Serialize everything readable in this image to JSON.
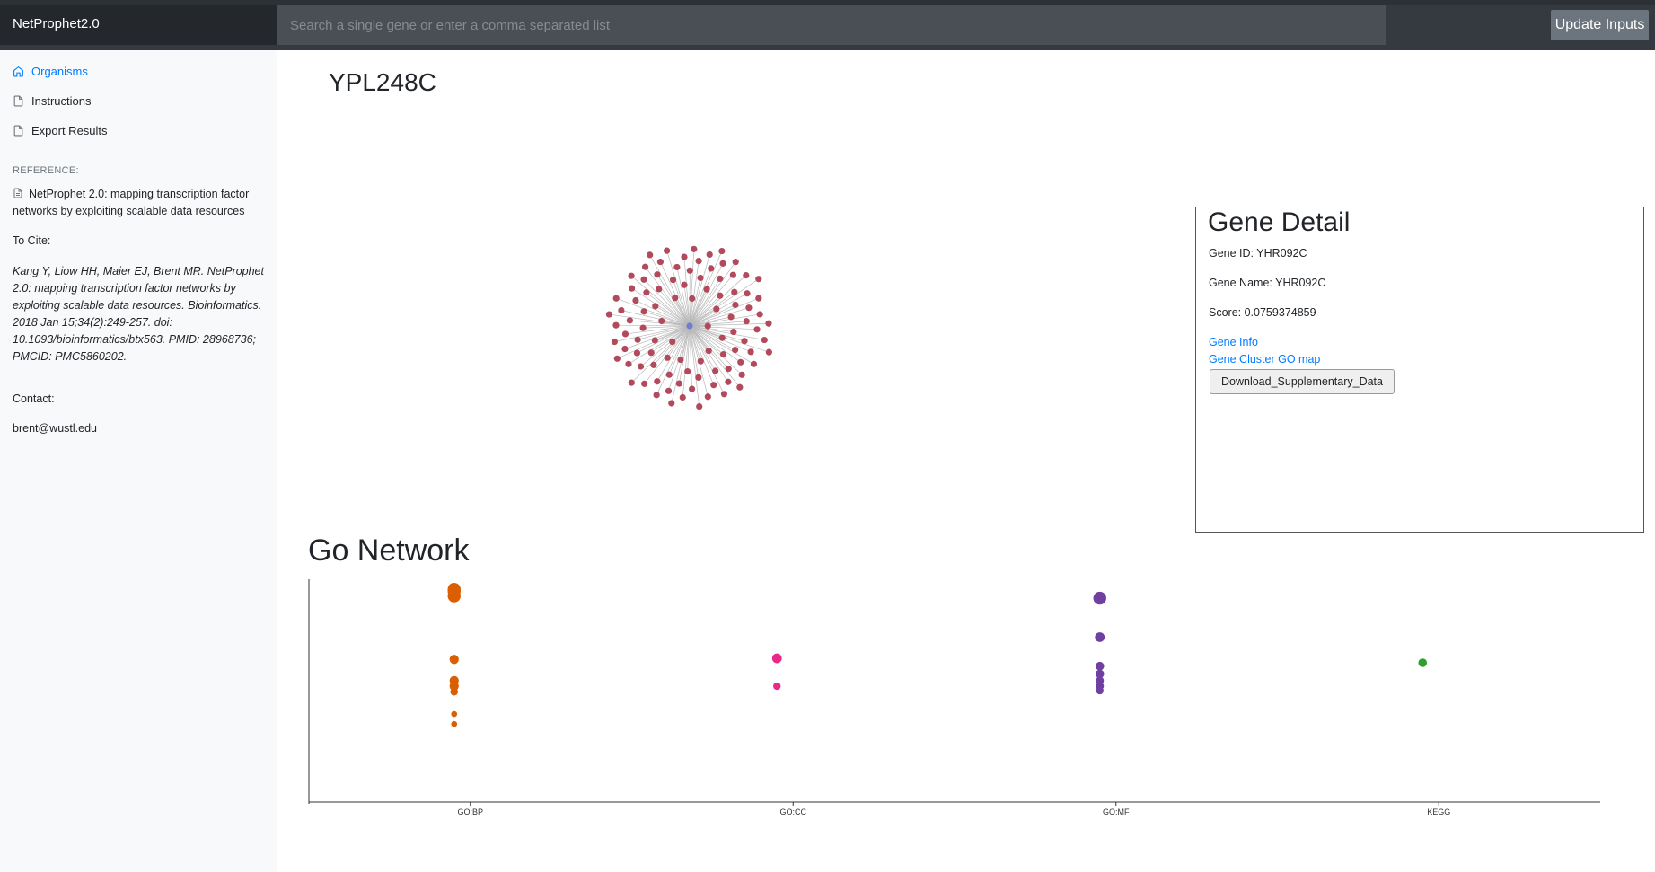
{
  "app": {
    "brand": "NetProphet2.0"
  },
  "search": {
    "placeholder": "Search a single gene or enter a comma separated list",
    "value": ""
  },
  "toolbar": {
    "update_label": "Update Inputs"
  },
  "sidebar": {
    "items": [
      {
        "label": "Organisms",
        "icon": "home-icon",
        "active": true
      },
      {
        "label": "Instructions",
        "icon": "file-icon",
        "active": false
      },
      {
        "label": "Export Results",
        "icon": "file-icon",
        "active": false
      }
    ],
    "reference_heading": "REFERENCE:",
    "reference_text": "NetProphet 2.0: mapping transcription factor networks by exploiting scalable data resources",
    "cite_label": "To Cite:",
    "citation": "Kang Y, Liow HH, Maier EJ, Brent MR. NetProphet 2.0: mapping transcription factor networks by exploiting scalable data resources. Bioinformatics. 2018 Jan 15;34(2):249-257. doi: 10.1093/bioinformatics/btx563. PMID: 28968736; PMCID: PMC5860202.",
    "contact_label": "Contact:",
    "contact_email": "brent@wustl.edu"
  },
  "main": {
    "gene_title": "YPL248C"
  },
  "network": {
    "center_color": "#6f7ecf",
    "node_color": "#b24a5c",
    "edge_color": "#b9b9b9",
    "target_count": 100
  },
  "gene_detail": {
    "heading": "Gene Detail",
    "gene_id": "Gene ID: YHR092C",
    "gene_name": "Gene Name: YHR092C",
    "score": "Score: 0.0759374859",
    "gene_info_link": "Gene Info",
    "cluster_link": "Gene Cluster GO map",
    "download_label": "Download_Supplementary_Data"
  },
  "go_network": {
    "title": "Go Network",
    "chart_data": {
      "type": "scatter",
      "categories": [
        "GO:BP",
        "GO:CC",
        "GO:MF",
        "KEGG"
      ],
      "colors": {
        "GO:BP": "#d95f02",
        "GO:CC": "#e7298a",
        "GO:MF": "#7040a0",
        "KEGG": "#2ca02c"
      },
      "ylim": [
        0,
        1
      ],
      "points": [
        {
          "category": "GO:BP",
          "y": 0.955,
          "r": 2.4
        },
        {
          "category": "GO:BP",
          "y": 0.945,
          "r": 2.4
        },
        {
          "category": "GO:BP",
          "y": 0.925,
          "r": 2.4
        },
        {
          "category": "GO:BP",
          "y": 0.64,
          "r": 1.7
        },
        {
          "category": "GO:BP",
          "y": 0.545,
          "r": 1.7
        },
        {
          "category": "GO:BP",
          "y": 0.52,
          "r": 1.7
        },
        {
          "category": "GO:BP",
          "y": 0.495,
          "r": 1.4
        },
        {
          "category": "GO:BP",
          "y": 0.395,
          "r": 1.1
        },
        {
          "category": "GO:BP",
          "y": 0.35,
          "r": 1.1
        },
        {
          "category": "GO:CC",
          "y": 0.645,
          "r": 1.8
        },
        {
          "category": "GO:CC",
          "y": 0.52,
          "r": 1.4
        },
        {
          "category": "GO:MF",
          "y": 0.915,
          "r": 2.4
        },
        {
          "category": "GO:MF",
          "y": 0.74,
          "r": 1.8
        },
        {
          "category": "GO:MF",
          "y": 0.61,
          "r": 1.6
        },
        {
          "category": "GO:MF",
          "y": 0.575,
          "r": 1.6
        },
        {
          "category": "GO:MF",
          "y": 0.545,
          "r": 1.5
        },
        {
          "category": "GO:MF",
          "y": 0.52,
          "r": 1.5
        },
        {
          "category": "GO:MF",
          "y": 0.5,
          "r": 1.4
        },
        {
          "category": "KEGG",
          "y": 0.625,
          "r": 1.6
        }
      ]
    }
  }
}
